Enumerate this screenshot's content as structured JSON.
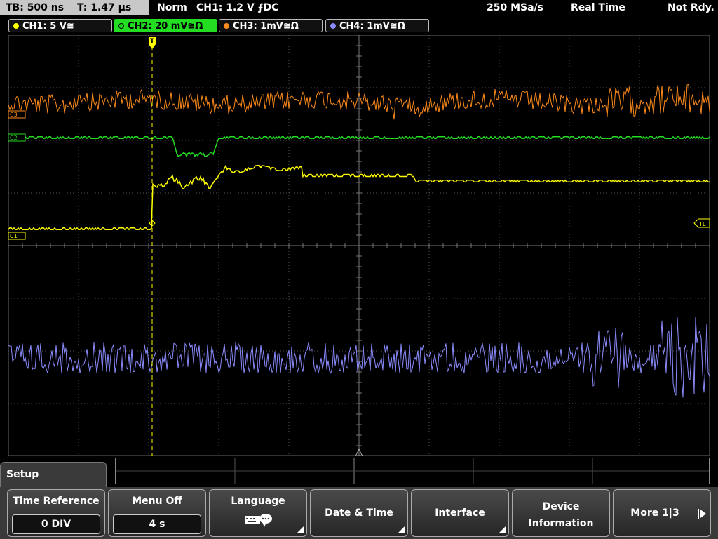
{
  "header": {
    "timebase": "TB: 500 ns",
    "trigger_time": "T: 1.47 µs",
    "trigger_mode": "Norm",
    "trigger_source": "CH1: 1.2 V ⨍DC",
    "sample_rate": "250 MSa/s",
    "acq_mode": "Real Time",
    "status": "Not Rdy."
  },
  "channels": [
    {
      "label": "CH1: 5 V≅",
      "color": "#ffff00",
      "active": false
    },
    {
      "label": "CH2: 20 mV≅Ω",
      "color": "#22dd22",
      "active": true
    },
    {
      "label": "CH3: 1mV≅Ω",
      "color": "#ff8c1a",
      "active": false
    },
    {
      "label": "CH4: 1mV≅Ω",
      "color": "#8c8cff",
      "active": false
    }
  ],
  "markers": {
    "c3": "C3",
    "c2": "C2",
    "c1": "C1",
    "tl": "TL"
  },
  "menu": {
    "title": "Setup",
    "time_reference": {
      "label": "Time Reference",
      "value": "0 DIV"
    },
    "menu_off": {
      "label": "Menu Off",
      "value": "4 s"
    },
    "language": {
      "label": "Language",
      "icon": "keyboard-speech-icon"
    },
    "date_time": {
      "label": "Date & Time"
    },
    "interface": {
      "label": "Interface"
    },
    "device_info": {
      "line1": "Device",
      "line2": "Information"
    },
    "more": {
      "label": "More 1|3"
    }
  },
  "colors": {
    "ch1": "#ffff00",
    "ch2": "#22dd22",
    "ch3": "#ff8c1a",
    "ch4": "#8c8cff",
    "grid": "#555555",
    "trigger": "#ffff00"
  }
}
